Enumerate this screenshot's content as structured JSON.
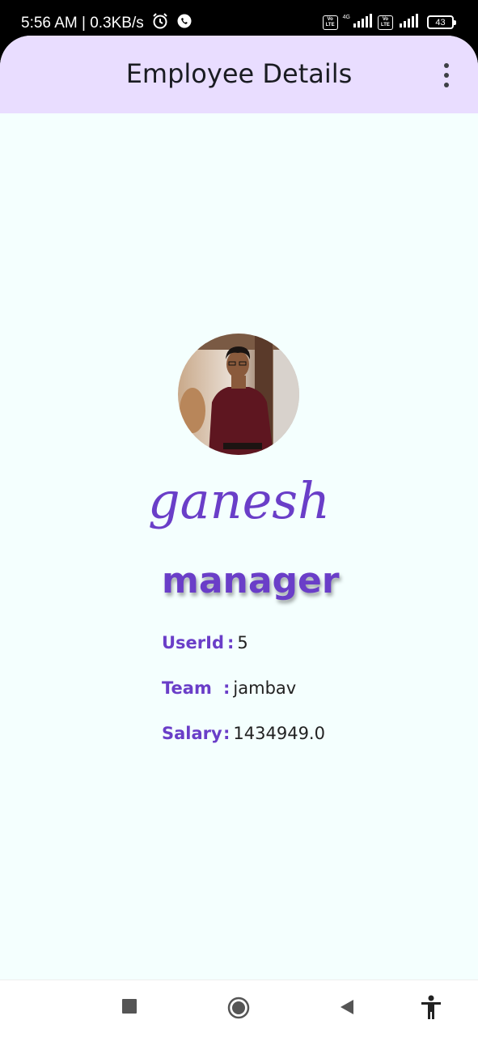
{
  "status_bar": {
    "time_speed": "5:56 AM | 0.3KB/s",
    "net_type": "4G",
    "volte_label_top": "Vo",
    "volte_label_bottom": "LTE",
    "battery": "43"
  },
  "app_bar": {
    "title": "Employee Details",
    "menu_icon": "more-vert-icon"
  },
  "employee": {
    "name": "ganesh",
    "role": "manager",
    "fields": [
      {
        "label": "UserId",
        "separator": ":",
        "value": "5"
      },
      {
        "label": "Team",
        "separator": ":",
        "value": "jambav"
      },
      {
        "label": "Salary",
        "separator": ":",
        "value": "1434949.0"
      }
    ]
  },
  "nav_bar": {
    "buttons": [
      "recents-icon",
      "home-icon",
      "back-icon",
      "accessibility-icon"
    ]
  },
  "colors": {
    "accent": "#6a3ec8",
    "app_bar_bg": "#e9ddff",
    "page_bg": "#f4fffe"
  }
}
